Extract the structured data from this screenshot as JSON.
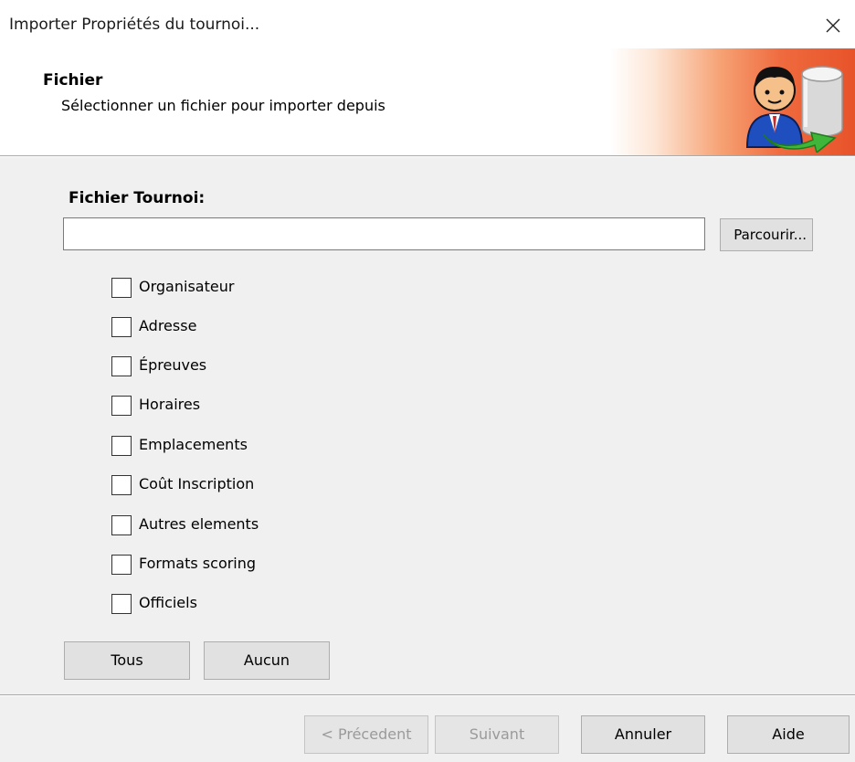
{
  "window": {
    "title": "Importer Propriétés du tournoi..."
  },
  "header": {
    "title": "Fichier",
    "subtitle": "Sélectionner un fichier pour importer depuis",
    "icon": "user-database-import-icon"
  },
  "file": {
    "label": "Fichier Tournoi:",
    "value": "",
    "placeholder": "",
    "browse_label": "Parcourir..."
  },
  "options": [
    {
      "label": "Organisateur",
      "checked": false
    },
    {
      "label": "Adresse",
      "checked": false
    },
    {
      "label": "Épreuves",
      "checked": false
    },
    {
      "label": "Horaires",
      "checked": false
    },
    {
      "label": "Emplacements",
      "checked": false
    },
    {
      "label": "Coût Inscription",
      "checked": false
    },
    {
      "label": "Autres elements",
      "checked": false
    },
    {
      "label": "Formats scoring",
      "checked": false
    },
    {
      "label": "Officiels",
      "checked": false
    }
  ],
  "selection": {
    "all_label": "Tous",
    "none_label": "Aucun"
  },
  "footer": {
    "previous_label": "< Précedent",
    "next_label": "Suivant",
    "cancel_label": "Annuler",
    "help_label": "Aide",
    "previous_enabled": false,
    "next_enabled": false
  },
  "colors": {
    "header_accent": "#e8532a",
    "window_bg": "#f0f0f0",
    "button_bg": "#e1e1e1"
  }
}
